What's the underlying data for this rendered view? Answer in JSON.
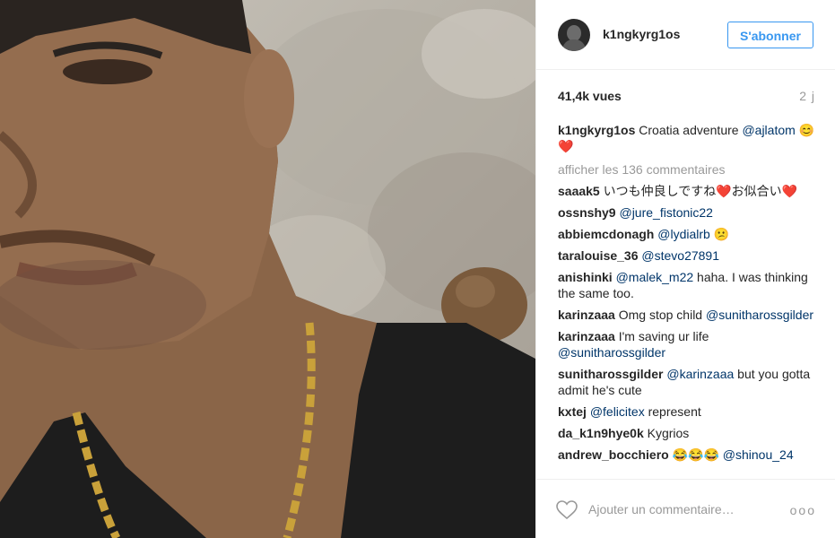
{
  "post": {
    "username": "k1ngkyrg1os",
    "follow_label": "S'abonner",
    "views": "41,4k vues",
    "time_ago": "2 j"
  },
  "caption": {
    "user": "k1ngkyrg1os",
    "text": "Croatia adventure",
    "mention": "@ajlatom",
    "emoji1": "😊",
    "emoji2": "❤️"
  },
  "load_more": "afficher les 136 commentaires",
  "comments": [
    {
      "user": "saaak5",
      "text": "いつも仲良しですね❤️お似合い❤️"
    },
    {
      "user": "ossnshy9",
      "mention": "@jure_fistonic22"
    },
    {
      "user": "abbiemcdonagh",
      "mention": "@lydialrb",
      "emoji": "😕"
    },
    {
      "user": "taralouise_36",
      "mention": "@stevo27891"
    },
    {
      "user": "anishinki",
      "mention": "@malek_m22",
      "text": "haha. I was thinking the same too."
    },
    {
      "user": "karinzaaa",
      "text": "Omg stop child",
      "mention": "@sunitharossgilder"
    },
    {
      "user": "karinzaaa",
      "text": "I'm saving ur life",
      "mention": "@sunitharossgilder"
    },
    {
      "user": "sunitharossgilder",
      "mention": "@karinzaaa",
      "text": "but you gotta admit he's cute"
    },
    {
      "user": "kxtej",
      "mention": "@felicitex",
      "text": "represent"
    },
    {
      "user": "da_k1n9hye0k",
      "text": "Kygrios"
    },
    {
      "user": "andrew_bocchiero",
      "text": "😂😂😂",
      "mention": "@shinou_24"
    }
  ],
  "footer": {
    "add_comment_placeholder": "Ajouter un commentaire…",
    "options": "ooo"
  }
}
